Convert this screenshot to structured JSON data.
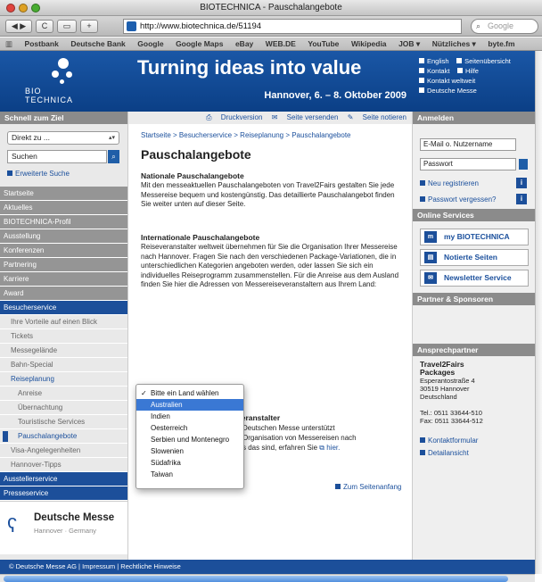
{
  "window": {
    "title": "BIOTECHNICA - Pauschalangebote"
  },
  "toolbar": {
    "back": "◀",
    "forward": "▶",
    "reload": "C",
    "add": "+",
    "url": "http://www.biotechnica.de/51194",
    "search_placeholder": "Google"
  },
  "bookmarks": [
    "Postbank",
    "Deutsche Bank",
    "Google",
    "Google Maps",
    "eBay",
    "WEB.DE",
    "YouTube",
    "Wikipedia",
    "JOB ▾",
    "Nützliches ▾",
    "byte.fm"
  ],
  "header": {
    "logo_line1": "BIO",
    "logo_line2": "TECHNICA",
    "tagline": "Turning ideas into value",
    "dates": "Hannover, 6. – 8. Oktober 2009",
    "links": [
      "English",
      "Seitenübersicht",
      "Kontakt",
      "Hilfe",
      "Kontakt weltweit",
      "Deutsche Messe"
    ]
  },
  "left": {
    "heading": "Schnell zum Ziel",
    "direct_select": "Direkt zu ...",
    "search_placeholder": "Suchen",
    "extended_search": "Erweiterte Suche",
    "nav": [
      {
        "label": "Startseite",
        "style": "grey"
      },
      {
        "label": "Aktuelles",
        "style": "grey"
      },
      {
        "label": "BIOTECHNICA-Profil",
        "style": "grey"
      },
      {
        "label": "Ausstellung",
        "style": "grey"
      },
      {
        "label": "Konferenzen",
        "style": "grey"
      },
      {
        "label": "Partnering",
        "style": "grey"
      },
      {
        "label": "Karriere",
        "style": "grey"
      },
      {
        "label": "Award",
        "style": "grey"
      },
      {
        "label": "Besucherservice",
        "style": "blue"
      },
      {
        "label": "Ihre Vorteile auf einen Blick",
        "style": "sub"
      },
      {
        "label": "Tickets",
        "style": "sub"
      },
      {
        "label": "Messegelände",
        "style": "sub"
      },
      {
        "label": "Bahn-Special",
        "style": "sub"
      },
      {
        "label": "Reiseplanung",
        "style": "sub-active"
      },
      {
        "label": "Anreise",
        "style": "sub2"
      },
      {
        "label": "Übernachtung",
        "style": "sub2"
      },
      {
        "label": "Touristische Services",
        "style": "sub2"
      },
      {
        "label": "Pauschalangebote",
        "style": "sub2-active"
      },
      {
        "label": "Visa-Angelegenheiten",
        "style": "sub"
      },
      {
        "label": "Hannover-Tipps",
        "style": "sub"
      },
      {
        "label": "Ausstellerservice",
        "style": "blue"
      },
      {
        "label": "Presseservice",
        "style": "blue"
      }
    ],
    "dm_name": "Deutsche Messe",
    "dm_sub": "Hannover · Germany"
  },
  "center": {
    "util": [
      "Druckversion",
      "Seite versenden",
      "Seite notieren"
    ],
    "breadcrumb": "Startseite > Besucherservice > Reiseplanung > Pauschalangebote",
    "title": "Pauschalangebote",
    "section1_title": "Nationale Pauschalangebote",
    "section1_text": "Mit den messeaktuellen Pauschalangeboten von Travel2Fairs gestalten Sie jede Messereise bequem und kostengünstig. Das detaillierte Pauschalangebot finden Sie weiter unten auf dieser Seite.",
    "section2_title": "Internationale Pauschalangebote",
    "section2_text": "Reiseveranstalter weltweit übernehmen für Sie die Organisation Ihrer Messereise nach Hannover. Fragen Sie nach den verschiedenen Package-Variationen, die in unterschiedlichen Kategorien angeboten werden, oder lassen Sie sich ein individuelles Reiseprogramm zusammenstellen. Für die Anreise aus dem Ausland finden Sie hier die Adressen von Messereiseveranstaltern aus Ihrem Land:",
    "partial_heading": "veranstalter",
    "partial_line1": "Deutschen Messe unterstützt",
    "partial_line2": "Organisation von Messereisen nach",
    "partial_line3": "s das sind, erfahren Sie",
    "partial_link": "hier",
    "top_link": "Zum Seitenanfang"
  },
  "dropdown": {
    "options": [
      "Bitte ein Land wählen",
      "Australien",
      "Indien",
      "Oesterreich",
      "Serbien und Montenegro",
      "Slowenien",
      "Südafrika",
      "Taiwan"
    ],
    "checked_index": 0,
    "highlighted_index": 1
  },
  "right": {
    "login_heading": "Anmelden",
    "email_placeholder": "E-Mail o. Nutzername",
    "password_placeholder": "Passwort",
    "register": "Neu registrieren",
    "forgot": "Passwort vergessen?",
    "services_heading": "Online Services",
    "services": [
      "my BIOTECHNICA",
      "Notierte Seiten",
      "Newsletter Service"
    ],
    "partner_heading": "Partner & Sponsoren",
    "contact_heading": "Ansprechpartner",
    "contact_name1": "Travel2Fairs",
    "contact_name2": "Packages",
    "contact_addr1": "Esperantostraße 4",
    "contact_addr2": "30519 Hannover",
    "contact_addr3": "Deutschland",
    "contact_tel": "Tel.: 0511 33644-510",
    "contact_fax": "Fax: 0511 33644-512",
    "contact_form": "Kontaktformular",
    "contact_detail": "Detailansicht"
  },
  "footer": {
    "text": "© Deutsche Messe AG | Impressum | Rechtliche Hinweise"
  },
  "colors": {
    "brand_blue": "#1c4f9a",
    "nav_grey": "#959595",
    "highlight": "#3a78d4"
  }
}
